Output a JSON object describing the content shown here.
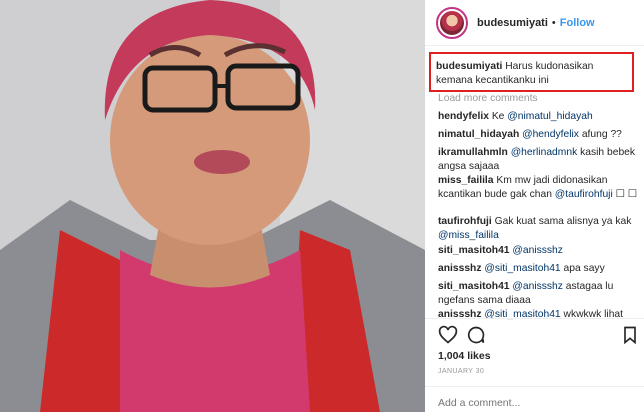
{
  "post": {
    "username": "budesumiyati",
    "separator": "•",
    "follow_label": "Follow"
  },
  "caption": {
    "username": "budesumiyati",
    "text": "Harus kudonasikan kemana kecantikanku ini"
  },
  "load_more_label": "Load more comments",
  "comments": [
    {
      "user": "hendyfelix",
      "pre": "Ke ",
      "mention": "@nimatul_hidayah",
      "post": ""
    },
    {
      "user": "nimatul_hidayah",
      "pre": "",
      "mention": "@hendyfelix",
      "post": " afung ??"
    },
    {
      "user": "ikramullahmln",
      "pre": "",
      "mention": "@herlinadmnk",
      "post": " kasih bebek angsa sajaaa"
    },
    {
      "user": "miss_failila",
      "pre": "Km mw jadi didonasikan kcantikan bude gak chan ",
      "mention": "@taufirohfuji",
      "post": " ☐ ☐"
    },
    {
      "user": "taufirohfuji",
      "pre": "Gak kuat sama alisnya ya kak ",
      "mention": "@miss_failila",
      "post": ""
    },
    {
      "user": "siti_masitoh41",
      "pre": "",
      "mention": "@anissshz",
      "post": ""
    },
    {
      "user": "anissshz",
      "pre": "",
      "mention": "@siti_masitoh41",
      "post": " apa sayy"
    },
    {
      "user": "siti_masitoh41",
      "pre": "",
      "mention": "@anissshz",
      "post": " astagaa lu ngefans sama diaaa"
    },
    {
      "user": "anissshz",
      "pre": "",
      "mention": "@siti_masitoh41",
      "post": " wkwkwk lihat"
    }
  ],
  "likes_label": "1,004 likes",
  "date_label": "JANUARY 30",
  "add_comment_placeholder": "Add a comment...",
  "icons": {
    "heart": "heart-icon",
    "comment": "comment-icon",
    "bookmark": "bookmark-icon",
    "avatar": "avatar"
  },
  "colors": {
    "follow": "#3897f0",
    "mention": "#003569",
    "highlight_box": "#e02020",
    "muted": "#999999"
  }
}
